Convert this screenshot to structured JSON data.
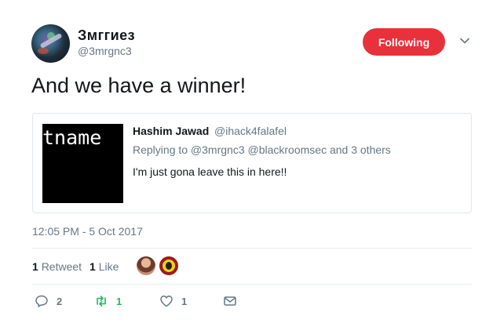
{
  "author": {
    "display_name": "Змггиез",
    "handle": "@3mrgnc3"
  },
  "follow_button": {
    "label": "Following",
    "color": "#e8313a"
  },
  "tweet": {
    "text": "And we have a winner!",
    "timestamp": "12:05 PM - 5 Oct 2017"
  },
  "quoted_tweet": {
    "image_text": "tname",
    "author_name": "Hashim Jawad",
    "author_handle": "@ihack4falafel",
    "replying_to": "Replying to @3mrgnc3 @blackroomsec and 3 others",
    "text": "I'm just gona leave this in here!!"
  },
  "stats": {
    "retweet_count": "1",
    "retweet_label": "Retweet",
    "like_count": "1",
    "like_label": "Like"
  },
  "actions": {
    "reply_count": "2",
    "retweet_count": "1",
    "like_count": "1"
  },
  "icons": [
    "chevron-down-icon",
    "reply-icon",
    "retweet-icon",
    "heart-icon",
    "envelope-icon"
  ],
  "colors": {
    "retweet_green": "#17bf63",
    "muted": "#657786"
  }
}
